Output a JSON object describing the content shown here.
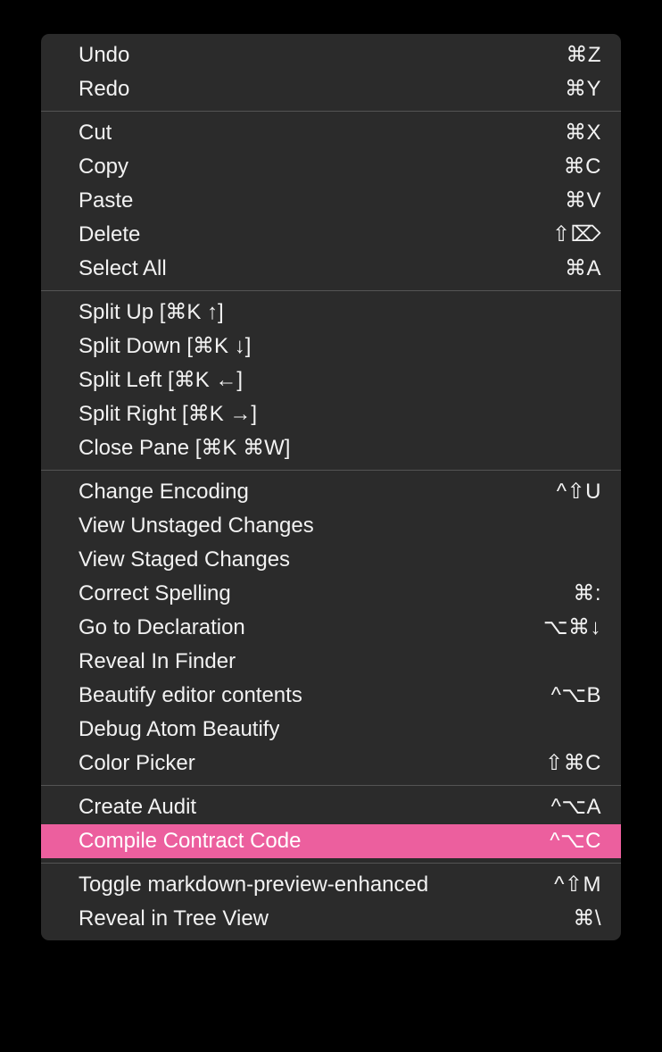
{
  "menu": {
    "type": "context-menu",
    "theme": {
      "background": "#2b2b2b",
      "text": "#f2f2f2",
      "separator": "#545454",
      "highlight_background": "#ec5f9e",
      "highlight_text": "#ffffff",
      "page_background": "#000000"
    },
    "sections": [
      {
        "name": "history",
        "items": [
          {
            "label": "Undo",
            "shortcut": "⌘Z",
            "highlighted": false
          },
          {
            "label": "Redo",
            "shortcut": "⌘Y",
            "highlighted": false
          }
        ]
      },
      {
        "name": "clipboard",
        "items": [
          {
            "label": "Cut",
            "shortcut": "⌘X",
            "highlighted": false
          },
          {
            "label": "Copy",
            "shortcut": "⌘C",
            "highlighted": false
          },
          {
            "label": "Paste",
            "shortcut": "⌘V",
            "highlighted": false
          },
          {
            "label": "Delete",
            "shortcut": "⇧⌦",
            "highlighted": false
          },
          {
            "label": "Select All",
            "shortcut": "⌘A",
            "highlighted": false
          }
        ]
      },
      {
        "name": "panes",
        "items": [
          {
            "label": "Split Up [⌘K ↑]",
            "shortcut": "",
            "highlighted": false
          },
          {
            "label": "Split Down [⌘K ↓]",
            "shortcut": "",
            "highlighted": false
          },
          {
            "label": "Split Left [⌘K ←]",
            "shortcut": "",
            "highlighted": false
          },
          {
            "label": "Split Right [⌘K →]",
            "shortcut": "",
            "highlighted": false
          },
          {
            "label": "Close Pane [⌘K ⌘W]",
            "shortcut": "",
            "highlighted": false
          }
        ]
      },
      {
        "name": "editor-tools",
        "items": [
          {
            "label": "Change Encoding",
            "shortcut": "^⇧U",
            "highlighted": false
          },
          {
            "label": "View Unstaged Changes",
            "shortcut": "",
            "highlighted": false
          },
          {
            "label": "View Staged Changes",
            "shortcut": "",
            "highlighted": false
          },
          {
            "label": "Correct Spelling",
            "shortcut": "⌘:",
            "highlighted": false
          },
          {
            "label": "Go to Declaration",
            "shortcut": "⌥⌘↓",
            "highlighted": false
          },
          {
            "label": "Reveal In Finder",
            "shortcut": "",
            "highlighted": false
          },
          {
            "label": "Beautify editor contents",
            "shortcut": "^⌥B",
            "highlighted": false
          },
          {
            "label": "Debug Atom Beautify",
            "shortcut": "",
            "highlighted": false
          },
          {
            "label": "Color Picker",
            "shortcut": "⇧⌘C",
            "highlighted": false
          }
        ]
      },
      {
        "name": "contract-tools",
        "items": [
          {
            "label": "Create Audit",
            "shortcut": "^⌥A",
            "highlighted": false
          },
          {
            "label": "Compile Contract Code",
            "shortcut": "^⌥C",
            "highlighted": true
          }
        ]
      },
      {
        "name": "view-tools",
        "items": [
          {
            "label": "Toggle markdown-preview-enhanced",
            "shortcut": "^⇧M",
            "highlighted": false
          },
          {
            "label": "Reveal in Tree View",
            "shortcut": "⌘\\",
            "highlighted": false
          }
        ]
      }
    ]
  }
}
